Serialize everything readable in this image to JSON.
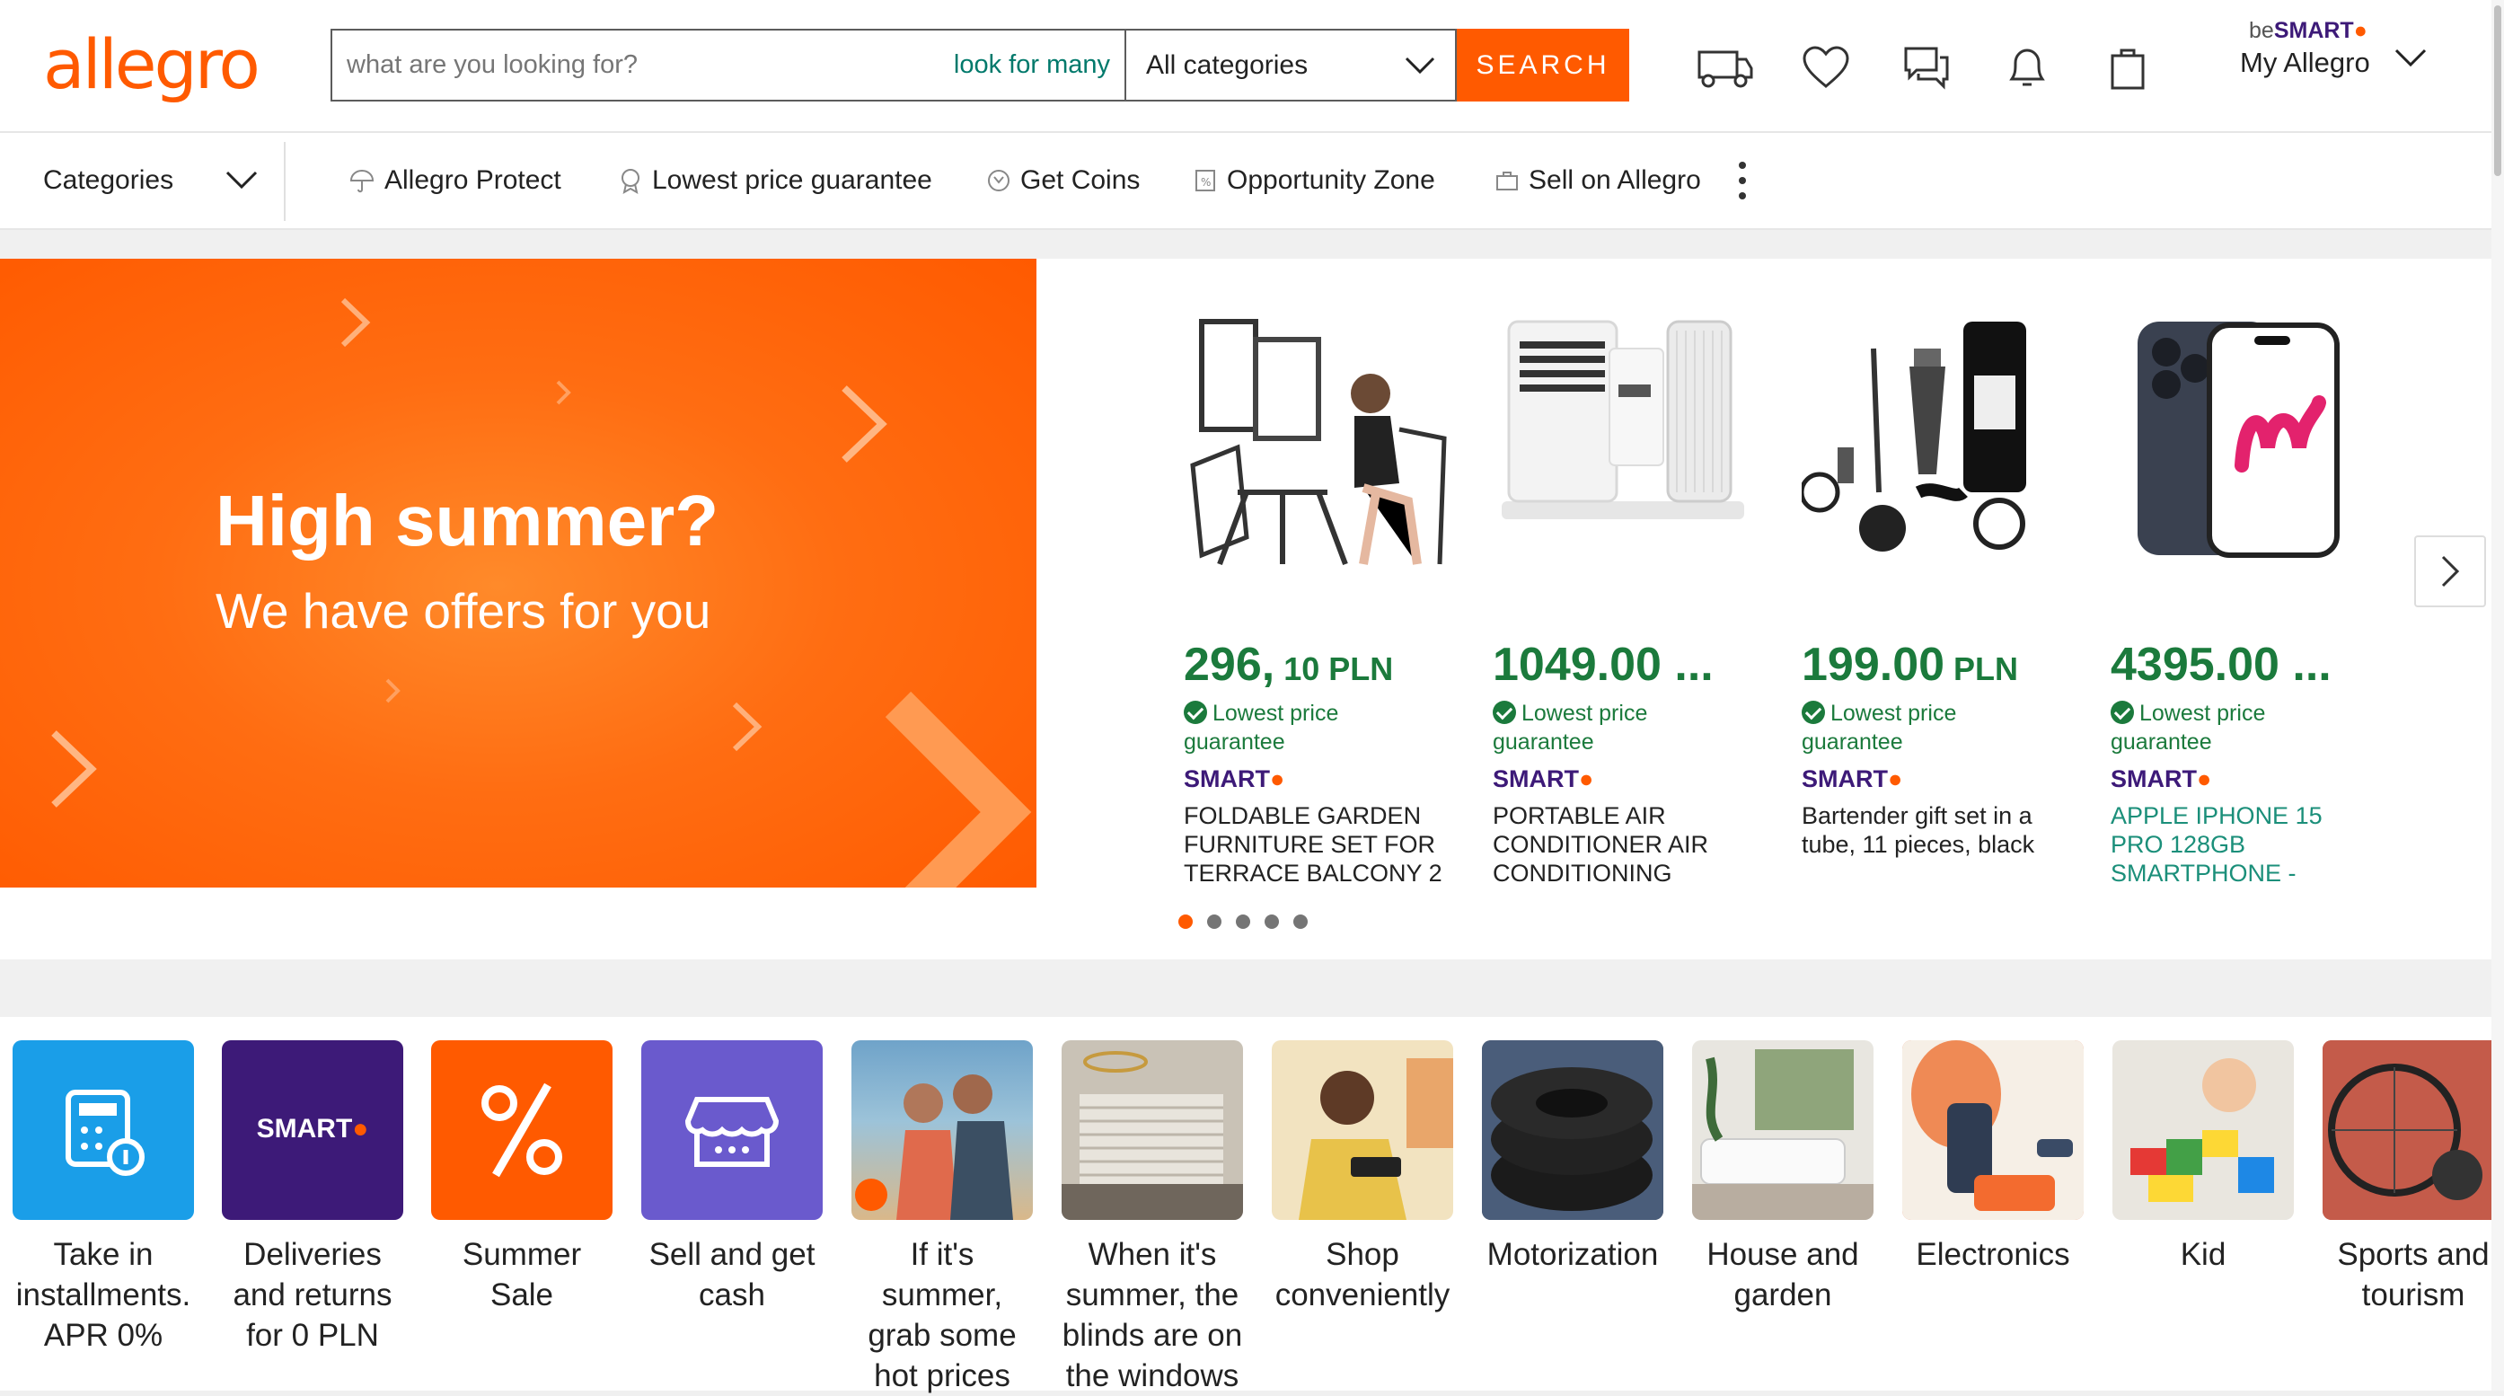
{
  "header": {
    "logo": "allegro",
    "search_placeholder": "what are you looking for?",
    "look_for_many": "look for many",
    "category_select": "All categories",
    "search_button": "SEARCH",
    "besmart_be": "be",
    "besmart_smart": "SMART",
    "my_allegro": "My Allegro"
  },
  "nav": {
    "categories": "Categories",
    "items": [
      "Allegro Protect",
      "Lowest price guarantee",
      "Get Coins",
      "Opportunity Zone",
      "Sell on Allegro"
    ]
  },
  "banner": {
    "title": "High summer?",
    "subtitle": "We have offers for you"
  },
  "products": [
    {
      "price_main": "296,",
      "price_cents": " 10",
      "price_cur": " PLN",
      "guarantee": "Lowest price guarantee",
      "smart": "SMART",
      "name": "FOLDABLE GARDEN FURNITURE SET FOR TERRACE BALCONY 2"
    },
    {
      "price_main": "1049.00 ...",
      "price_cents": "",
      "price_cur": "",
      "guarantee": "Lowest price guarantee",
      "smart": "SMART",
      "name": "PORTABLE AIR CONDITIONER AIR CONDITIONING"
    },
    {
      "price_main": "199.00",
      "price_cents": "",
      "price_cur": " PLN",
      "guarantee": "Lowest price guarantee",
      "smart": "SMART",
      "name": "Bartender gift set in a tube, 11 pieces, black"
    },
    {
      "price_main": "4395.00 ...",
      "price_cents": "",
      "price_cur": "",
      "guarantee": "Lowest price guarantee",
      "smart": "SMART",
      "name": "APPLE IPHONE 15 PRO 128GB SMARTPHONE -"
    }
  ],
  "carousel": {
    "pages": 5,
    "active": 1
  },
  "tiles": [
    {
      "label": "Take in installments. APR 0%",
      "icon": "calculator-icon",
      "bg": "#1a9ee8"
    },
    {
      "label": "Deliveries and returns for 0 PLN",
      "icon": "smart-logo",
      "bg": "#3d1a78"
    },
    {
      "label": "Summer Sale",
      "icon": "percent-icon",
      "bg": "#ff5a00"
    },
    {
      "label": "Sell and get cash",
      "icon": "shop-icon",
      "bg": "#6a5acd"
    },
    {
      "label": "If it's summer, grab some hot prices",
      "icon": "couple-photo",
      "bg": "#6fa3c9"
    },
    {
      "label": "When it's summer, the blinds are on the windows",
      "icon": "blinds-photo",
      "bg": "#8a7f72"
    },
    {
      "label": "Shop conveniently",
      "icon": "woman-phone-photo",
      "bg": "#e8c24a"
    },
    {
      "label": "Motorization",
      "icon": "tires-photo",
      "bg": "#3c3c3c"
    },
    {
      "label": "House and garden",
      "icon": "livingroom-photo",
      "bg": "#cfcac0"
    },
    {
      "label": "Electronics",
      "icon": "phones-photo",
      "bg": "#e8734a"
    },
    {
      "label": "Kid",
      "icon": "blocks-photo",
      "bg": "#d8d4cc"
    },
    {
      "label": "Sports and tourism",
      "icon": "bike-photo",
      "bg": "#b35a4a"
    }
  ],
  "tile_smart_text": "SMART",
  "colors": {
    "brand": "#ff5a00",
    "price_green": "#1b7a3c",
    "smart_purple": "#3d1a78"
  }
}
